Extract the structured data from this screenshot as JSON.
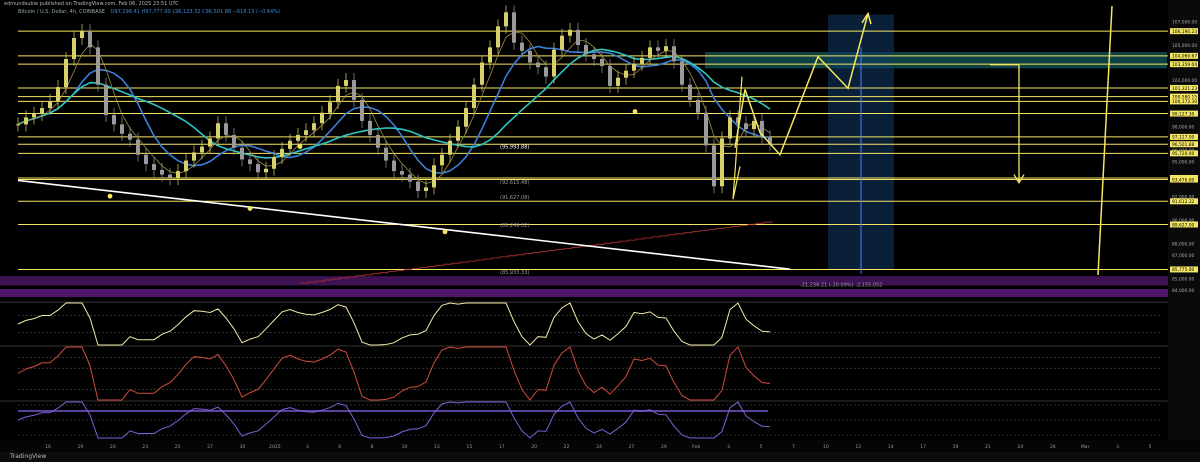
{
  "header": {
    "publish_line": "edmundsubie published on TradingView.com, Feb 06, 2025 23:51 UTC",
    "symbol_line": "Bitcoin / U.S. Dollar, 4h, COINBASE",
    "ohlc_text": "O97,199.41  H97,777.00  L96,123.32  C96,501.88  −618.13 (−0.64%)"
  },
  "footer": {
    "brand": "TradingView"
  },
  "colors": {
    "background": "#000000",
    "level": "#f5e663",
    "candle_up": "#d8d06a",
    "candle_down": "#9a9a9a",
    "ema_fast": "#3b7fd9",
    "ema_slow": "#2ec4c4",
    "trend": "#ffffff",
    "purple_band": "#5a1a78",
    "zone_teal": "#0f4c4f",
    "zone_blue": "#123a66",
    "red_steps": "#b5332e"
  },
  "chart_data": [
    {
      "type": "line",
      "title": "",
      "price_axis_labels": [
        "107,000.00",
        "106,190.23",
        "105,000.00",
        "104,069.67",
        "103,359.04",
        "102,000.00",
        "101,321.23",
        "100,580.15",
        "100,172.30",
        "99,127.30",
        "98,000.00",
        "97,127.00",
        "96,501.88",
        "96,000.00",
        "95,720.00",
        "95,000.00",
        "93,609.00",
        "93,476.00",
        "92,000.00",
        "91,612.32",
        "90,000.00",
        "89,627.00",
        "88,000.00",
        "87,000.00",
        "85,775.00",
        "85,000.00",
        "84,000.00"
      ],
      "price_range": [
        83500,
        108000
      ],
      "level_lines": [
        106190,
        104070,
        103360,
        101320,
        100580,
        100170,
        99130,
        97127,
        96500,
        95720,
        93610,
        93476,
        91612,
        89627,
        85775
      ],
      "annotations": [
        "(95,993.88)",
        "(92,615.48)",
        "(91,627.08)",
        "(89,249.32)",
        "(85,933.33)",
        "-21,238.21 (-20.09%) -2,155,052"
      ],
      "x_tick_labels": [
        "16",
        "19",
        "20",
        "23",
        "25",
        "27",
        "30",
        "2025",
        "3",
        "6",
        "8",
        "10",
        "13",
        "15",
        "17",
        "20",
        "22",
        "24",
        "27",
        "29",
        "Feb",
        "3",
        "5",
        "7",
        "10",
        "12",
        "14",
        "17",
        "19",
        "21",
        "24",
        "26",
        "Mar",
        "3",
        "5"
      ],
      "price_series": {
        "name": "BTCUSD 4h close (approx.)",
        "values": [
          98200,
          98800,
          99100,
          99600,
          100200,
          101400,
          103800,
          105600,
          106200,
          104800,
          101600,
          99000,
          98200,
          97400,
          96900,
          95600,
          94800,
          94300,
          93900,
          93600,
          94200,
          95100,
          95800,
          96300,
          97000,
          98300,
          97300,
          96200,
          95200,
          94800,
          94100,
          94400,
          95400,
          96100,
          96800,
          97300,
          97700,
          98300,
          99200,
          100100,
          101500,
          102000,
          100300,
          98500,
          97300,
          96200,
          95100,
          94200,
          93900,
          93300,
          92500,
          92800,
          94700,
          95600,
          96800,
          98000,
          99600,
          101600,
          103500,
          104800,
          106600,
          107800,
          105200,
          104500,
          103500,
          103100,
          102300,
          104600,
          105800,
          106300,
          105000,
          104200,
          103800,
          103200,
          101500,
          102200,
          102800,
          103400,
          103900,
          104800,
          104500,
          104900,
          103600,
          101600,
          100300,
          99200,
          96400,
          92900,
          97000,
          98800,
          98300,
          97800,
          98500,
          97100,
          96500
        ]
      },
      "projection_path_prices": [
        96200,
        95600,
        97800,
        101300,
        104000,
        102000,
        100200,
        105700,
        107700
      ],
      "rsi": {
        "levels": [
          "60.0",
          "40.0"
        ],
        "range": [
          25,
          75
        ]
      },
      "stoch": {
        "levels": [
          "80.00",
          "60.00",
          "20.00"
        ],
        "range": [
          0,
          100
        ]
      },
      "bottom_pane": {
        "levels": [
          "2.50",
          "0.00",
          "-2.50"
        ],
        "range": [
          -3,
          3
        ]
      }
    }
  ]
}
